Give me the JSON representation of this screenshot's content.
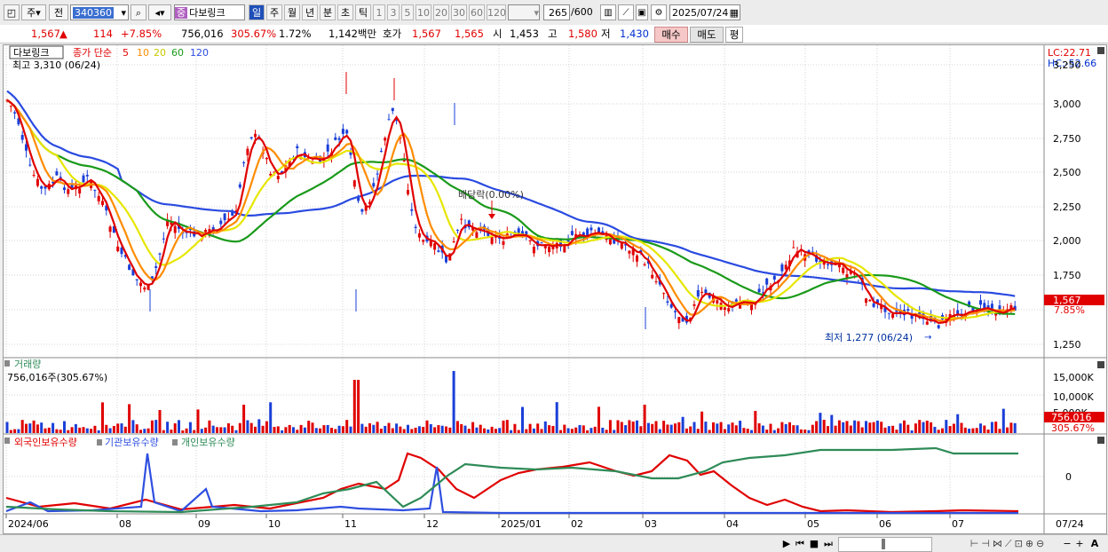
{
  "toolbar": {
    "market": "주",
    "prev": "전",
    "code": "340360",
    "name": "다보링크",
    "name_tag": "중",
    "periods": [
      "일",
      "주",
      "월",
      "년",
      "분",
      "초",
      "틱"
    ],
    "minutes": [
      "1",
      "3",
      "5",
      "10",
      "20",
      "30",
      "60",
      "120"
    ],
    "count": "265",
    "total": "/600",
    "date": "2025/07/24",
    "icons": [
      "dropdown-icon",
      "search-icon",
      "speaker-icon",
      "candle-icon",
      "line-icon",
      "save-icon",
      "settings-icon",
      "calendar-icon"
    ]
  },
  "quote": {
    "price": "1,567",
    "arrow": "▲",
    "change": "114",
    "change_pct": "+7.85%",
    "volume": "756,016",
    "vol_ratio": "305.67%",
    "turnover": "1.72%",
    "amount": "1,142백만",
    "bid_label": "호가",
    "bid1": "1,567",
    "bid2": "1,565",
    "open_label": "시",
    "open": "1,453",
    "high_label": "고",
    "high": "1,580",
    "low_label": "저",
    "low": "1,430",
    "buy": "매수",
    "sell": "매도",
    "eval": "평"
  },
  "price_panel": {
    "name": "다보링크",
    "legend_label": "종가 단순",
    "ma_labels": [
      "5",
      "10",
      "20",
      "60",
      "120"
    ],
    "high_note": "최고 3,310 (06/24)",
    "low_note": "최저 1,277 (06/24)",
    "dividend_note": "배당락(0.00%)",
    "lc": "LC:22.71",
    "hc": "HC:-52.66",
    "y_ticks": [
      "3,250",
      "3,000",
      "2,750",
      "2,500",
      "2,250",
      "2,000",
      "1,750",
      "1,567",
      "1,250"
    ],
    "current_price": "1,567",
    "current_pct": "7.85%"
  },
  "volume_panel": {
    "title": "거래량",
    "value": "756,016주(305.67%)",
    "y_ticks": [
      "15,000K",
      "10,000K",
      "5,000K"
    ],
    "current": "756,016",
    "current_pct": "305.67%"
  },
  "holdings_panel": {
    "legend": [
      "외국인보유수량",
      "기관보유수량",
      "개인보유수량"
    ],
    "y_ticks": [
      "0"
    ]
  },
  "x_axis": [
    "2024/06",
    "08",
    "09",
    "10",
    "11",
    "12",
    "2025/01",
    "02",
    "03",
    "04",
    "05",
    "06",
    "07",
    "07/24"
  ],
  "colors": {
    "up": "#e00000",
    "down": "#1a3fd8",
    "ma5": "#e00000",
    "ma10": "#ff8c00",
    "ma20": "#e6e600",
    "ma60": "#1a9a1a",
    "ma120": "#2a4be0",
    "institution": "#2f4fe0",
    "individual": "#2e8b57"
  }
}
